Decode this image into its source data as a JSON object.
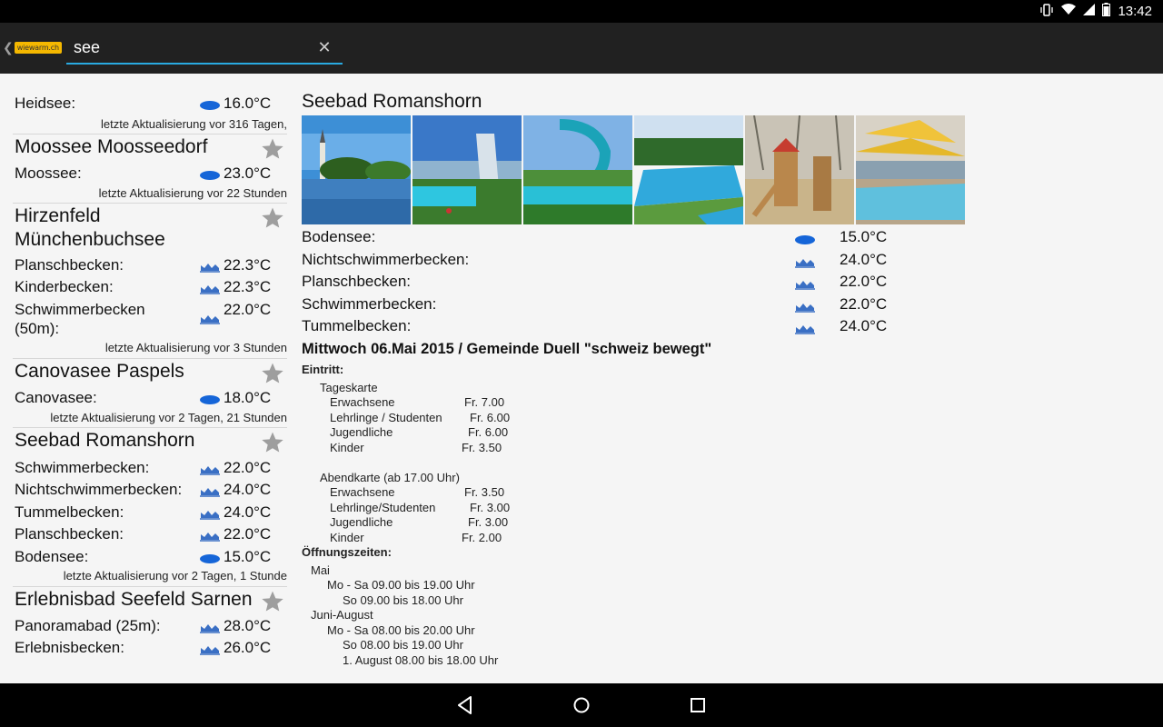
{
  "status": {
    "time": "13:42"
  },
  "search": {
    "value": "see",
    "logo": "wiewarm.ch"
  },
  "left_list": {
    "heidsee": {
      "label": "Heidsee:",
      "value": "16.0°C",
      "updated": "letzte Aktualisierung vor 316 Tagen,"
    },
    "moossee": {
      "title": "Moossee Moosseedorf",
      "label": "Moossee:",
      "value": "23.0°C",
      "updated": "letzte Aktualisierung vor 22 Stunden"
    },
    "hirzenfeld": {
      "title1": "Hirzenfeld",
      "title2": "Münchenbuchsee",
      "rows": [
        {
          "label": "Planschbecken:",
          "value": "22.3°C"
        },
        {
          "label": "Kinderbecken:",
          "value": "22.3°C"
        },
        {
          "label": "Schwimmerbecken",
          "label2": "(50m):",
          "value": "22.0°C"
        }
      ],
      "updated": "letzte Aktualisierung vor 3 Stunden"
    },
    "canovasee": {
      "title": "Canovasee Paspels",
      "label": "Canovasee:",
      "value": "18.0°C",
      "updated": "letzte Aktualisierung vor 2 Tagen, 21 Stunden"
    },
    "romanshorn": {
      "title": "Seebad Romanshorn",
      "rows": [
        {
          "label": "Schwimmerbecken:",
          "value": "22.0°C"
        },
        {
          "label": "Nichtschwimmerbecken:",
          "value": "24.0°C"
        },
        {
          "label": "Tummelbecken:",
          "value": "24.0°C"
        },
        {
          "label": "Planschbecken:",
          "value": "22.0°C"
        },
        {
          "label": "Bodensee:",
          "value": "15.0°C"
        }
      ],
      "updated": "letzte Aktualisierung vor 2 Tagen, 1 Stunde"
    },
    "seefeld": {
      "title": "Erlebnisbad Seefeld Sarnen",
      "rows": [
        {
          "label": "Panoramabad (25m):",
          "value": "28.0°C"
        },
        {
          "label": "Erlebnisbecken:",
          "value": "26.0°C"
        }
      ]
    }
  },
  "detail": {
    "title": "Seebad Romanshorn",
    "temps": [
      {
        "label": "Bodensee:",
        "value": "15.0°C",
        "icon": "lake-icon"
      },
      {
        "label": "Nichtschwimmerbecken:",
        "value": "24.0°C",
        "icon": "pool-icon"
      },
      {
        "label": "Planschbecken:",
        "value": "22.0°C",
        "icon": "pool-icon"
      },
      {
        "label": "Schwimmerbecken:",
        "value": "22.0°C",
        "icon": "pool-icon"
      },
      {
        "label": "Tummelbecken:",
        "value": "24.0°C",
        "icon": "pool-icon"
      }
    ],
    "event": "Mittwoch 06.Mai 2015 / Gemeinde Duell \"schweiz bewegt\"",
    "eintritt": "Eintritt:",
    "tageskarte": "Tageskarte",
    "tages_rows": [
      {
        "label": "Erwachsene",
        "price": "Fr.  7.00"
      },
      {
        "label": "Lehrlinge / Studenten",
        "price": "Fr.  6.00"
      },
      {
        "label": "Jugendliche",
        "price": "Fr.  6.00"
      },
      {
        "label": "Kinder",
        "price": "Fr.  3.50"
      }
    ],
    "abendkarte": "Abendkarte (ab 17.00 Uhr)",
    "abend_rows": [
      {
        "label": "Erwachsene",
        "price": "Fr.  3.50"
      },
      {
        "label": "Lehrlinge/Studenten",
        "price": "Fr.  3.00"
      },
      {
        "label": "Jugendliche",
        "price": "Fr.  3.00"
      },
      {
        "label": "Kinder",
        "price": "Fr.  2.00"
      }
    ],
    "oeffnung": "Öffnungszeiten:",
    "mai": "Mai",
    "mai_rows": [
      "Mo - Sa 09.00 bis 19.00 Uhr",
      "So 09.00 bis 18.00 Uhr"
    ],
    "juni": "Juni-August",
    "juni_rows": [
      "Mo - Sa 08.00 bis 20.00 Uhr",
      "So 08.00 bis 19.00 Uhr",
      "1. August 08.00 bis 18.00 Uhr"
    ]
  },
  "colors": {
    "accent": "#29a9e0",
    "lake_icon": "#1565d8",
    "pool_icon": "#3a6fc4",
    "star": "#9e9e9e"
  }
}
